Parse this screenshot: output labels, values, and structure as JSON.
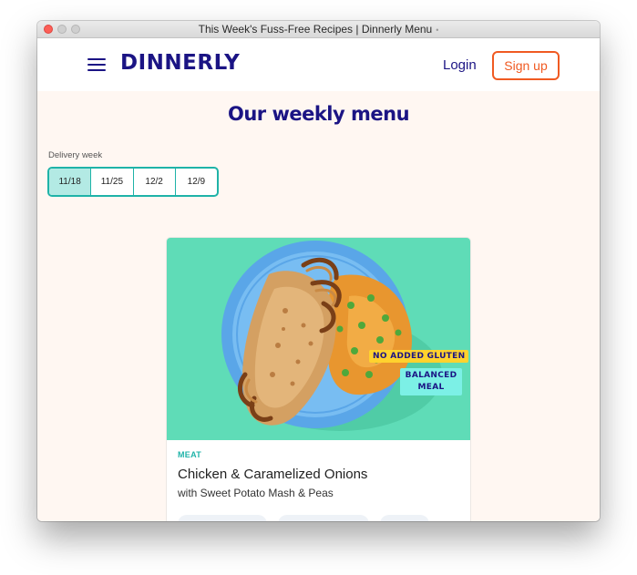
{
  "window": {
    "title": "This Week's Fuss-Free Recipes | Dinnerly Menu",
    "title_marker": "•"
  },
  "header": {
    "menu_icon": "hamburger-menu-icon",
    "logo": "DINNERLY",
    "login_label": "Login",
    "signup_label": "Sign up"
  },
  "main": {
    "title": "Our weekly menu",
    "delivery_label": "Delivery week",
    "weeks": [
      {
        "label": "11/18",
        "selected": true
      },
      {
        "label": "11/25",
        "selected": false
      },
      {
        "label": "12/2",
        "selected": false
      },
      {
        "label": "12/9",
        "selected": false
      }
    ]
  },
  "recipe": {
    "category": "MEAT",
    "title": "Chicken & Caramelized Onions",
    "subtitle": "with Sweet Potato Mash & Peas",
    "badges": {
      "gluten": "NO ADDED GLUTEN",
      "balanced_line1": "BALANCED",
      "balanced_line2": "MEAL"
    }
  },
  "colors": {
    "brand_navy": "#1b1484",
    "accent_orange": "#f05a22",
    "teal": "#1fb3a8",
    "page_bg": "#fff7f2",
    "image_bg": "#5fdcb7"
  }
}
